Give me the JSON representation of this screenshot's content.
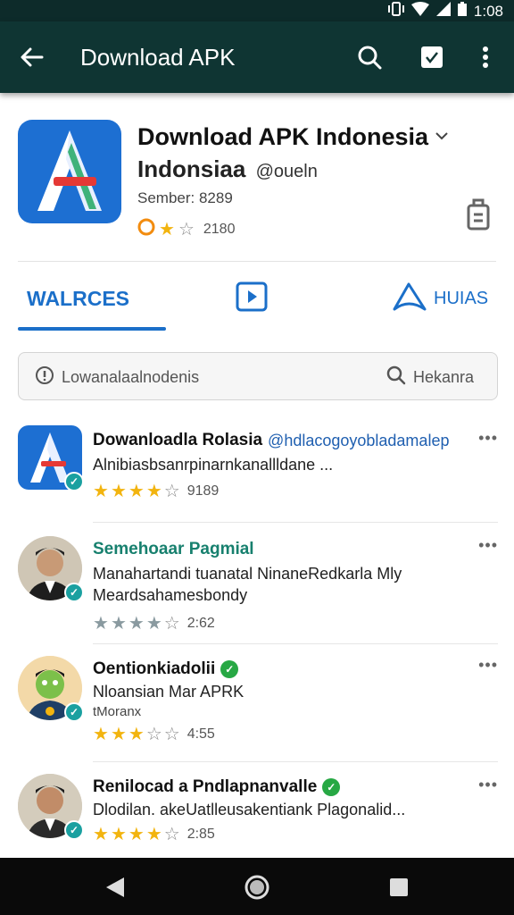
{
  "status_bar": {
    "time": "1:08"
  },
  "app_bar": {
    "title": "Download APK"
  },
  "app": {
    "title": "Download APK Indonesia",
    "subtitle": "Indonsiaa",
    "handle": "@oueln",
    "meta": "Sember: 8289",
    "rating_count": "2180",
    "brand_color": "#1d6fd2"
  },
  "tabs": [
    {
      "label": "WALRCES",
      "active": true
    },
    {
      "label": "",
      "icon": "play-box-icon",
      "active": false
    },
    {
      "label": "HUIAS",
      "icon": "send-arrow-icon",
      "active": false
    }
  ],
  "search": {
    "left_text": "Lowanalaalnodenis",
    "right_text": "Hekanra"
  },
  "results": [
    {
      "name": "Dowanloadla Rolasia",
      "handle": "@hdlacogoyobladamalep",
      "line1": "Alnibiasbsanrpinarnkanallldane ...",
      "line2": "",
      "stars": 4,
      "star_color": "#f2b40f",
      "count": "9189"
    },
    {
      "name": "Semehoaar Pagmial",
      "handle": "",
      "line1": "Manahartandi tuanatal NinaneRedkarla Mly",
      "line2": "Meardsahamesbondy",
      "stars": 4,
      "star_color": "#8a9aa0",
      "count": "2:62"
    },
    {
      "name": "Oentionkiadolii",
      "handle": "",
      "line1": "Nloansian Mar APRK",
      "line2": "tMoranx",
      "stars": 3,
      "star_color": "#f2b40f",
      "count": "4:55"
    },
    {
      "name": "Renilocad a Pndlapnanvalle",
      "handle": "",
      "line1": "Dlodilan. akeUatlleusakentiank Plagonalid...",
      "line2": "",
      "stars": 4,
      "star_color": "#f2b40f",
      "count": "2:85"
    }
  ]
}
